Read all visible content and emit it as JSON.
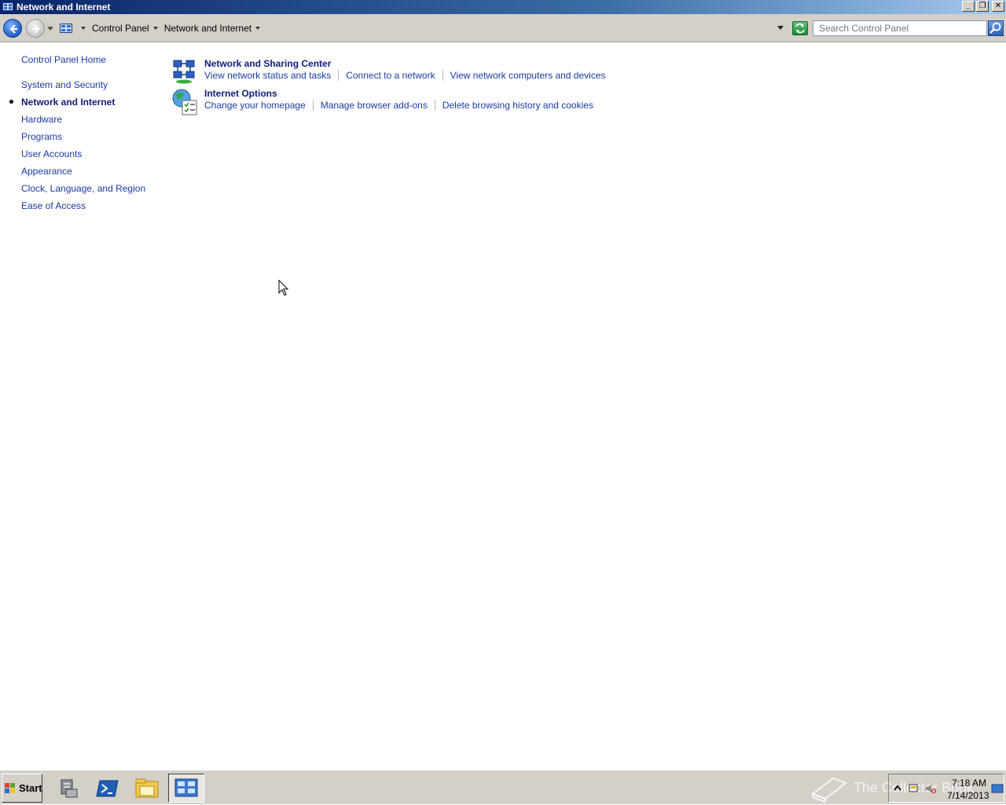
{
  "window": {
    "title": "Network and Internet"
  },
  "address": {
    "breadcrumbs": [
      "Control Panel",
      "Network and Internet"
    ]
  },
  "search": {
    "placeholder": "Search Control Panel"
  },
  "sidebar": {
    "items": [
      {
        "label": "Control Panel Home",
        "active": false
      },
      {
        "label": "System and Security",
        "active": false
      },
      {
        "label": "Network and Internet",
        "active": true
      },
      {
        "label": "Hardware",
        "active": false
      },
      {
        "label": "Programs",
        "active": false
      },
      {
        "label": "User Accounts",
        "active": false
      },
      {
        "label": "Appearance",
        "active": false
      },
      {
        "label": "Clock, Language, and Region",
        "active": false
      },
      {
        "label": "Ease of Access",
        "active": false
      }
    ]
  },
  "categories": [
    {
      "title": "Network and Sharing Center",
      "icon": "network-sharing-icon",
      "links": [
        "View network status and tasks",
        "Connect to a network",
        "View network computers and devices"
      ]
    },
    {
      "title": "Internet Options",
      "icon": "internet-options-icon",
      "links": [
        "Change your homepage",
        "Manage browser add-ons",
        "Delete browsing history and cookies"
      ]
    }
  ],
  "taskbar": {
    "start_label": "Start",
    "pinned": [
      "server-manager-icon",
      "powershell-icon",
      "explorer-icon",
      "control-panel-icon"
    ]
  },
  "tray": {
    "time": "7:18 AM",
    "date": "7/14/2013"
  },
  "watermark": {
    "text": "The Collector Book"
  },
  "colors": {
    "link": "#1a3aa0",
    "heading": "#0f1d7a",
    "chrome": "#d4d0c8"
  }
}
